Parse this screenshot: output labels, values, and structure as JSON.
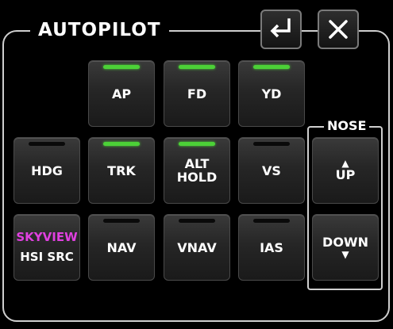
{
  "header": {
    "title": "AUTOPILOT"
  },
  "top_buttons": [
    {
      "name": "enter-button",
      "icon": "enter-return-icon"
    },
    {
      "name": "close-button",
      "icon": "close-x-icon"
    }
  ],
  "colors": {
    "led_on": "#4cd137",
    "skyview": "#e040e0",
    "frame": "#cfcfcf"
  },
  "buttons": {
    "ap": {
      "label": "AP",
      "led": true
    },
    "fd": {
      "label": "FD",
      "led": true
    },
    "yd": {
      "label": "YD",
      "led": true
    },
    "hdg": {
      "label": "HDG",
      "led": false
    },
    "trk": {
      "label": "TRK",
      "led": true
    },
    "alt_hold": {
      "line1": "ALT",
      "line2": "HOLD",
      "led": true
    },
    "vs": {
      "label": "VS",
      "led": false
    },
    "hsi_src": {
      "line1": "SKYVIEW",
      "line2": "HSI SRC"
    },
    "nav": {
      "label": "NAV",
      "led": false
    },
    "vnav": {
      "label": "VNAV",
      "led": false
    },
    "ias": {
      "label": "IAS",
      "led": false
    }
  },
  "nose": {
    "label": "NOSE",
    "up": {
      "arrow": "▲",
      "label": "UP"
    },
    "down": {
      "label": "DOWN",
      "arrow": "▼"
    }
  }
}
